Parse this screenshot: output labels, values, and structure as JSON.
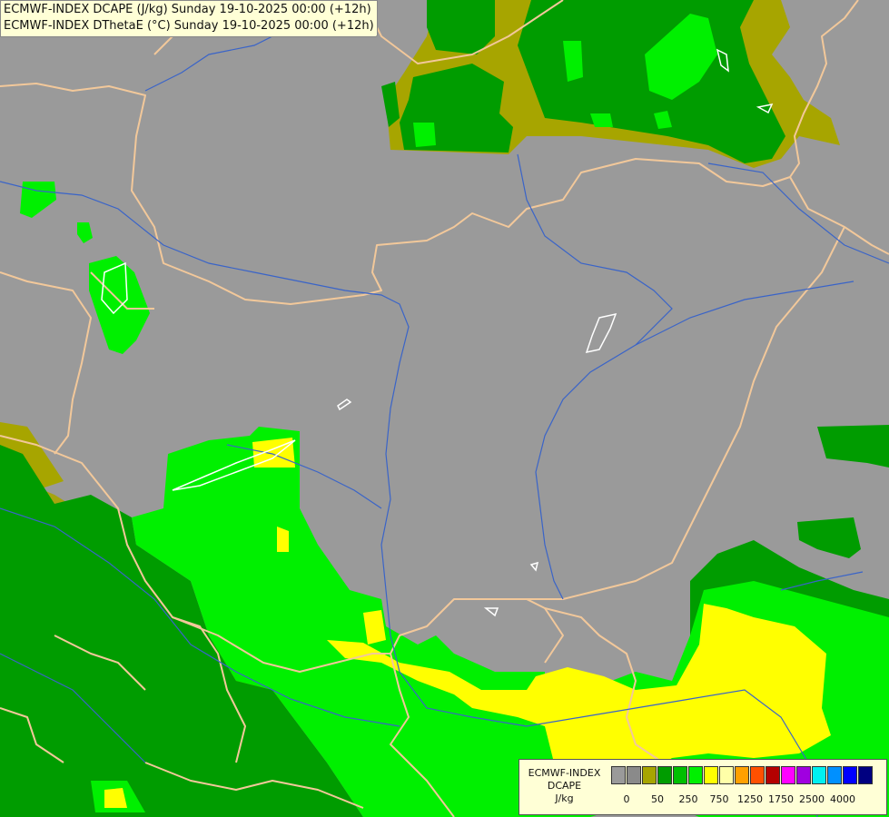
{
  "header": {
    "line1": "ECMWF-INDEX DCAPE (J/kg) Sunday 19-10-2025 00:00 (+12h)",
    "line2": "ECMWF-INDEX DThetaE (°C) Sunday 19-10-2025 00:00 (+12h)"
  },
  "legend": {
    "model": "ECMWF-INDEX",
    "parameter": "DCAPE",
    "unit": "J/kg",
    "colors": [
      "#9a9a9a",
      "#8a8a8a",
      "#a7a500",
      "#009c00",
      "#00bf00",
      "#00f000",
      "#ffff00",
      "#ffffa8",
      "#ffa000",
      "#ff5000",
      "#b40000",
      "#ff00ff",
      "#a000e0",
      "#00f0f0",
      "#0090ff",
      "#0000ff",
      "#000080"
    ],
    "ticks": [
      "0",
      "50",
      "250",
      "750",
      "1250",
      "1750",
      "2500",
      "4000"
    ]
  },
  "colors": {
    "background": "#9a9a9a",
    "olive": "#a7a500",
    "dark_green": "#009c00",
    "bright_green": "#00f000",
    "yellow": "#ffff00",
    "border": "#f2c89a",
    "river": "#3a64c8"
  }
}
